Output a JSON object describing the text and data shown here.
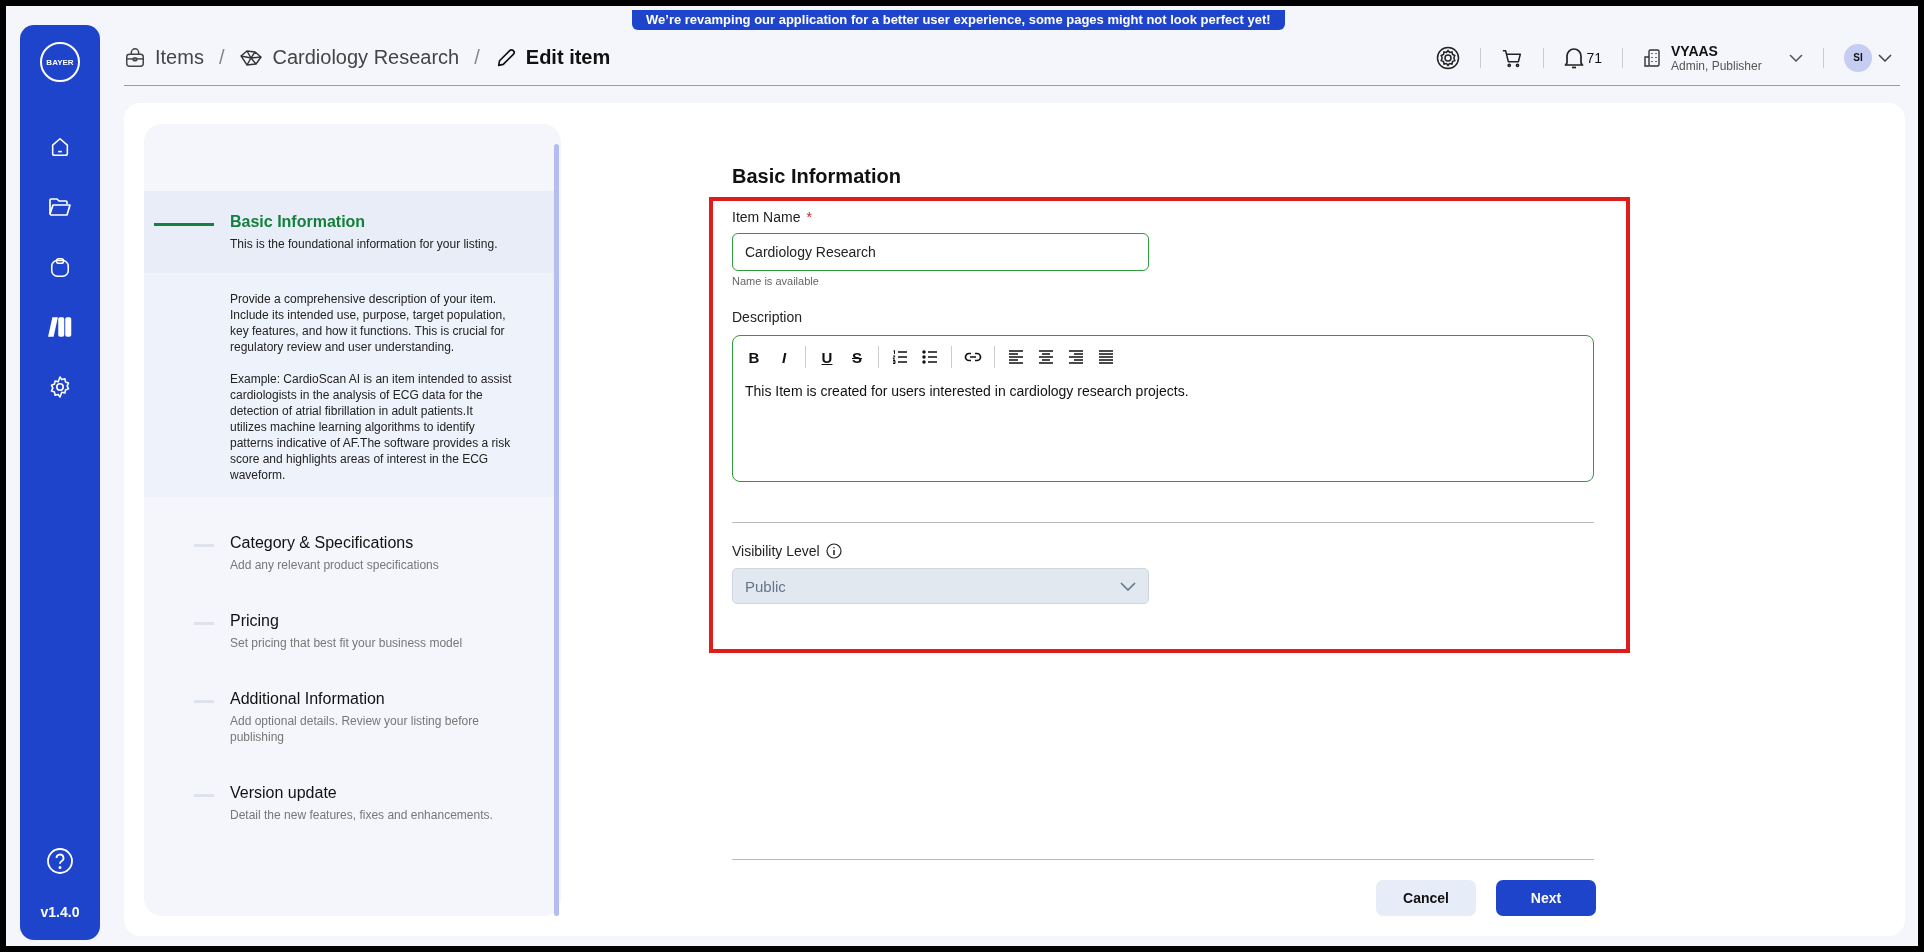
{
  "banner": "We’re revamping our application for a better user experience, some pages might not look perfect yet!",
  "sidebar": {
    "logo": "BAYER",
    "nav": [
      {
        "kind": "home",
        "selected": false
      },
      {
        "kind": "folder",
        "selected": false
      },
      {
        "kind": "bag",
        "selected": false
      },
      {
        "kind": "books",
        "selected": true
      },
      {
        "kind": "settings",
        "selected": false
      }
    ],
    "version": "v1.4.0"
  },
  "breadcrumb_separator": "/",
  "breadcrumb": [
    {
      "kind": "items",
      "label": "Items",
      "current": false
    },
    {
      "kind": "project",
      "label": "Cardiology Research",
      "current": false
    },
    {
      "kind": "edit",
      "label": "Edit item",
      "current": true
    }
  ],
  "header": {
    "notifications": "71",
    "org": {
      "name": "VYAAS",
      "roles": "Admin, Publisher"
    },
    "avatar": "SI"
  },
  "steps": [
    {
      "title": "Basic Information",
      "subtitle": "This is the foundational information for your listing.",
      "selected": true,
      "details": [
        "Provide a comprehensive description of your item. Include its intended use, purpose, target population, key features, and how it functions. This is crucial for regulatory review and user understanding.",
        "Example: CardioScan AI is an item intended to assist cardiologists in the analysis of ECG data for the detection of atrial fibrillation in adult patients.It utilizes machine learning algorithms to identify patterns indicative of AF.The software provides a risk score and highlights areas of interest in the ECG waveform."
      ]
    },
    {
      "title": "Category & Specifications",
      "subtitle": "Add any relevant product specifications",
      "selected": false
    },
    {
      "title": "Pricing",
      "subtitle": "Set pricing that best fit your business model",
      "selected": false
    },
    {
      "title": "Additional Information",
      "subtitle": "Add optional details. Review your listing before publishing",
      "selected": false
    },
    {
      "title": "Version update",
      "subtitle": "Detail the new features, fixes and enhancements.",
      "selected": false
    }
  ],
  "form": {
    "title": "Basic Information",
    "item_name": {
      "label": "Item Name",
      "required_mark": "*",
      "value": "Cardiology Research",
      "hint": "Name is available"
    },
    "description": {
      "label": "Description",
      "value": "This Item is created for users interested in cardiology research projects.",
      "toolbar": [
        [
          {
            "kind": "bold",
            "glyph": "B"
          },
          {
            "kind": "italic",
            "glyph": "I"
          }
        ],
        [
          {
            "kind": "underline",
            "glyph": "U"
          },
          {
            "kind": "strikethrough",
            "glyph": "S"
          }
        ],
        [
          {
            "kind": "ordered-list"
          },
          {
            "kind": "bullet-list"
          }
        ],
        [
          {
            "kind": "link"
          }
        ],
        [
          {
            "kind": "align-left"
          },
          {
            "kind": "align-center"
          },
          {
            "kind": "align-right"
          },
          {
            "kind": "justify"
          }
        ]
      ]
    },
    "visibility": {
      "label": "Visibility Level",
      "value": "Public",
      "disabled": true
    }
  },
  "buttons": [
    {
      "kind": "secondary",
      "label": "Cancel"
    },
    {
      "kind": "primary",
      "label": "Next"
    }
  ]
}
